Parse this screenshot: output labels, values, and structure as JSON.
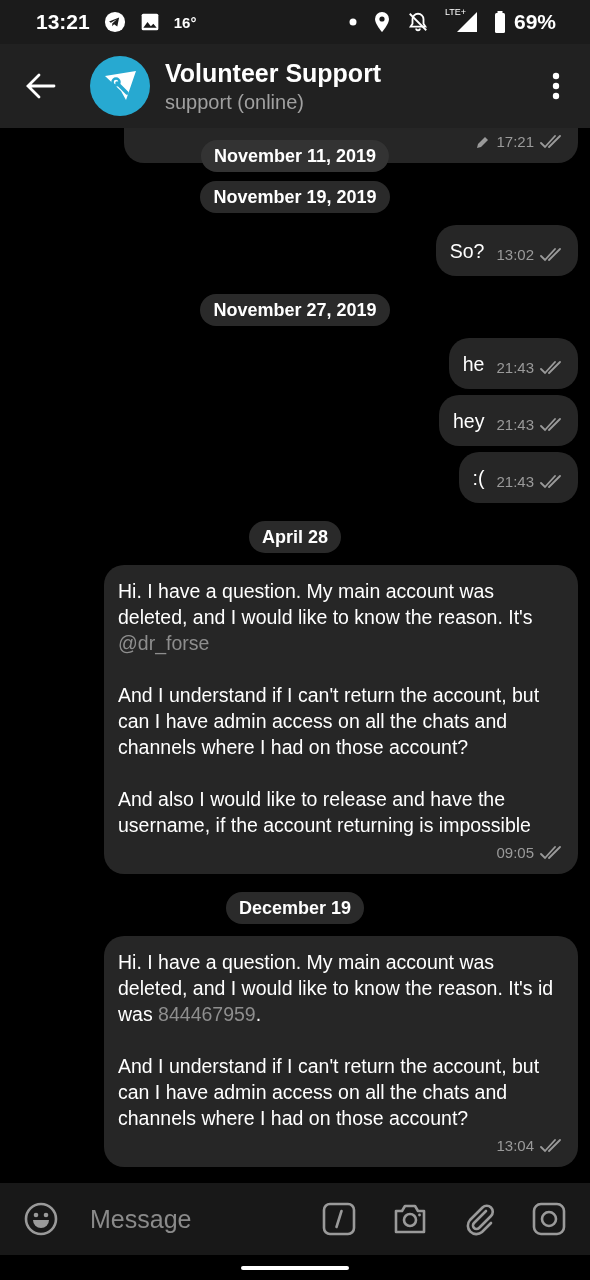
{
  "status_bar": {
    "time": "13:21",
    "temperature": "16°",
    "network": "LTE+",
    "battery": "69%"
  },
  "header": {
    "title": "Volunteer Support",
    "subtitle": "support (online)"
  },
  "floating_date": "November 11, 2019",
  "messages": [
    {
      "kind": "partial_message",
      "time": "17:21",
      "edited": true,
      "read": true
    },
    {
      "kind": "date",
      "text": "November 19, 2019"
    },
    {
      "kind": "message",
      "paragraphs": [
        [
          {
            "kind": "plain",
            "text": "So?"
          }
        ]
      ],
      "time": "13:02",
      "edited": false,
      "read": true
    },
    {
      "kind": "date",
      "text": "November 27, 2019"
    },
    {
      "kind": "message",
      "paragraphs": [
        [
          {
            "kind": "plain",
            "text": "he"
          }
        ]
      ],
      "time": "21:43",
      "edited": false,
      "read": true
    },
    {
      "kind": "message",
      "paragraphs": [
        [
          {
            "kind": "plain",
            "text": "hey"
          }
        ]
      ],
      "time": "21:43",
      "edited": false,
      "read": true
    },
    {
      "kind": "message",
      "paragraphs": [
        [
          {
            "kind": "plain",
            "text": ":("
          }
        ]
      ],
      "time": "21:43",
      "edited": false,
      "read": true
    },
    {
      "kind": "date",
      "text": "April 28"
    },
    {
      "kind": "message",
      "paragraphs": [
        [
          {
            "kind": "plain",
            "text": "Hi. I have a question. My main account was deleted, and I would like to know the reason. It's "
          },
          {
            "kind": "mention",
            "text": "@dr_forse"
          }
        ],
        [
          {
            "kind": "plain",
            "text": "And I understand if I can't return the account, but can I have admin access on all the chats and channels where I had on those account?"
          }
        ],
        [
          {
            "kind": "plain",
            "text": "And also I would like to release and have the username, if the account returning is impossible"
          }
        ]
      ],
      "time": "09:05",
      "edited": false,
      "read": true
    },
    {
      "kind": "date",
      "text": "December 19"
    },
    {
      "kind": "message",
      "paragraphs": [
        [
          {
            "kind": "plain",
            "text": "Hi. I have a question. My main account was deleted, and I would like to know the reason. It's id was "
          },
          {
            "kind": "number",
            "text": "844467959"
          },
          {
            "kind": "plain",
            "text": "."
          }
        ],
        [
          {
            "kind": "plain",
            "text": "And I understand if I can't return the account, but can I have admin access on all the chats and channels where I had on those account?"
          }
        ]
      ],
      "time": "13:04",
      "edited": false,
      "read": true
    }
  ],
  "input": {
    "placeholder": "Message"
  }
}
